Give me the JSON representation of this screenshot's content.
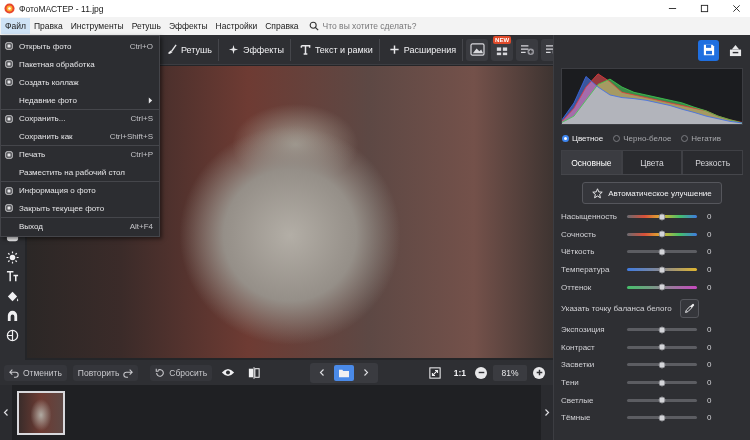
{
  "window": {
    "title": "ФотоМАСТЕР - 11.jpg"
  },
  "menu_bar": {
    "items": [
      {
        "label": "Файл",
        "selected": true
      },
      {
        "label": "Правка",
        "selected": false
      },
      {
        "label": "Инструменты",
        "selected": false
      },
      {
        "label": "Ретушь",
        "selected": false
      },
      {
        "label": "Эффекты",
        "selected": false
      },
      {
        "label": "Настройки",
        "selected": false
      },
      {
        "label": "Справка",
        "selected": false
      }
    ],
    "search": {
      "placeholder": "Что вы хотите сделать?"
    }
  },
  "file_menu": {
    "items": [
      {
        "label": "Открыть фото",
        "shortcut": "Ctrl+O",
        "kind": "iconed",
        "group_start": false,
        "submenu": false
      },
      {
        "label": "Пакетная обработка",
        "shortcut": "",
        "kind": "iconed",
        "group_start": false,
        "submenu": false
      },
      {
        "label": "Создать коллаж",
        "shortcut": "",
        "kind": "iconed",
        "group_start": false,
        "submenu": false
      },
      {
        "label": "Недавние фото",
        "shortcut": "",
        "kind": "plain",
        "group_start": false,
        "submenu": true
      },
      {
        "label": "Сохранить...",
        "shortcut": "Ctrl+S",
        "kind": "iconed",
        "group_start": true,
        "submenu": false
      },
      {
        "label": "Сохранить как",
        "shortcut": "Ctrl+Shift+S",
        "kind": "plain",
        "group_start": false,
        "submenu": false
      },
      {
        "label": "Печать",
        "shortcut": "Ctrl+P",
        "kind": "iconed",
        "group_start": true,
        "submenu": false
      },
      {
        "label": "Разместить на рабочий стол",
        "shortcut": "",
        "kind": "plain",
        "group_start": false,
        "submenu": false
      },
      {
        "label": "Информация о фото",
        "shortcut": "",
        "kind": "iconed",
        "group_start": true,
        "submenu": false
      },
      {
        "label": "Закрыть текущее фото",
        "shortcut": "",
        "kind": "iconed",
        "group_start": false,
        "submenu": false
      },
      {
        "label": "Выход",
        "shortcut": "Alt+F4",
        "kind": "plain",
        "group_start": true,
        "submenu": false
      }
    ]
  },
  "toolbar": {
    "tabs": [
      {
        "label": "Ретушь"
      },
      {
        "label": "Эффекты"
      },
      {
        "label": "Текст и рамки"
      },
      {
        "label": "Расширения"
      }
    ],
    "new_badge": "NEW"
  },
  "edit_bar": {
    "undo": "Отменить",
    "redo": "Повторить",
    "reset": "Сбросить",
    "actual_size": "1:1",
    "zoom": "81%"
  },
  "filmstrip": {
    "thumbnails": [
      {
        "selected": true
      }
    ]
  },
  "histogram": {
    "series": [
      {
        "name": "red",
        "color": "#e8383a",
        "values": [
          5,
          30,
          70,
          95,
          80,
          60,
          55,
          50,
          45,
          40,
          35,
          30,
          25,
          15,
          8,
          3
        ]
      },
      {
        "name": "green",
        "color": "#3ccf4e",
        "values": [
          3,
          15,
          45,
          75,
          85,
          70,
          60,
          55,
          50,
          45,
          40,
          32,
          25,
          15,
          8,
          2
        ]
      },
      {
        "name": "blue",
        "color": "#3a6cf0",
        "values": [
          8,
          40,
          90,
          70,
          55,
          50,
          48,
          45,
          40,
          35,
          28,
          22,
          15,
          10,
          5,
          2
        ]
      }
    ]
  },
  "color_modes": [
    {
      "label": "Цветное",
      "selected": true
    },
    {
      "label": "Черно-белое",
      "selected": false
    },
    {
      "label": "Негатив",
      "selected": false
    }
  ],
  "panel_tabs": [
    {
      "label": "Основные",
      "selected": true
    },
    {
      "label": "Цвета",
      "selected": false
    },
    {
      "label": "Резкость",
      "selected": false
    }
  ],
  "auto_button": "Автоматическое улучшение",
  "adjustments": [
    {
      "kind": "slider",
      "label": "Насыщенность",
      "level": 0.5,
      "reading": "0",
      "colors": [
        "#6a6a70",
        "#d8503a",
        "#e0b52e",
        "#45c06a",
        "#3f7be0"
      ]
    },
    {
      "kind": "slider",
      "label": "Сочность",
      "level": 0.5,
      "reading": "0",
      "colors": [
        "#6a6a70",
        "#d8503a",
        "#e0b52e",
        "#45c06a",
        "#3f7be0"
      ]
    },
    {
      "kind": "slider",
      "label": "Чёткость",
      "level": 0.5,
      "reading": "0",
      "colors": [
        "#5c5d62",
        "#5c5d62"
      ]
    },
    {
      "kind": "slider",
      "label": "Температура",
      "level": 0.5,
      "reading": "0",
      "colors": [
        "#3f7be0",
        "#8a8a90",
        "#e0b52e"
      ]
    },
    {
      "kind": "slider",
      "label": "Оттенок",
      "level": 0.5,
      "reading": "0",
      "colors": [
        "#45c06a",
        "#8a8a90",
        "#c848c0"
      ]
    },
    {
      "kind": "picker",
      "label": "Указать точку баланса белого"
    },
    {
      "kind": "slider",
      "label": "Экспозиция",
      "level": 0.5,
      "reading": "0",
      "colors": [
        "#5c5d62",
        "#5c5d62"
      ]
    },
    {
      "kind": "slider",
      "label": "Контраст",
      "level": 0.5,
      "reading": "0",
      "colors": [
        "#5c5d62",
        "#5c5d62"
      ]
    },
    {
      "kind": "slider",
      "label": "Засветки",
      "level": 0.5,
      "reading": "0",
      "colors": [
        "#5c5d62",
        "#5c5d62"
      ]
    },
    {
      "kind": "slider",
      "label": "Тени",
      "level": 0.5,
      "reading": "0",
      "colors": [
        "#5c5d62",
        "#5c5d62"
      ]
    },
    {
      "kind": "slider",
      "label": "Светлые",
      "level": 0.5,
      "reading": "0",
      "colors": [
        "#5c5d62",
        "#5c5d62"
      ]
    },
    {
      "kind": "slider",
      "label": "Тёмные",
      "level": 0.5,
      "reading": "0",
      "colors": [
        "#5c5d62",
        "#5c5d62"
      ]
    }
  ]
}
